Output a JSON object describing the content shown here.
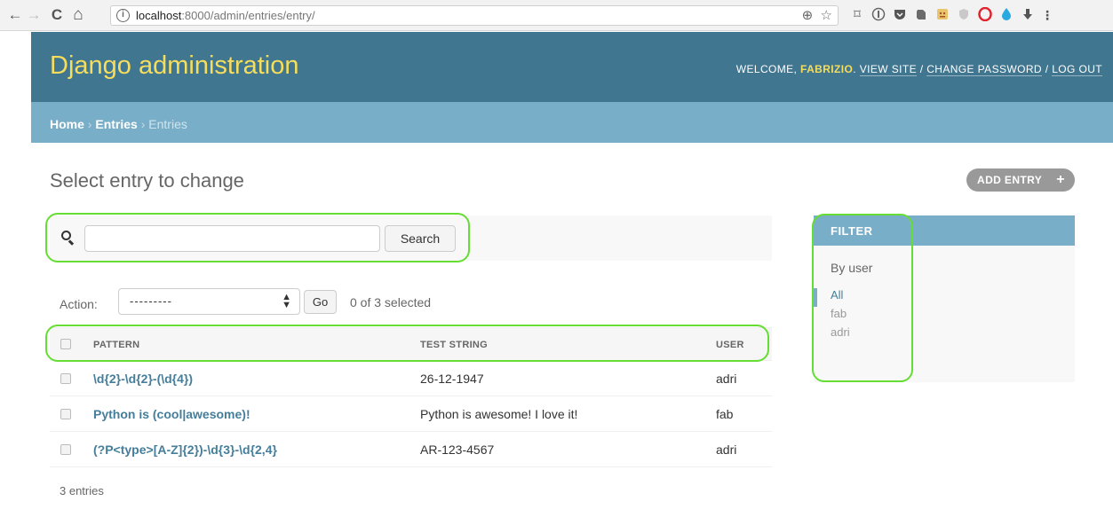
{
  "browser": {
    "url_host": "localhost",
    "url_rest": ":8000/admin/entries/entry/",
    "back_icon": "←",
    "forward_icon": "→",
    "reload_icon": "C",
    "home_icon": "⌂",
    "info_icon": "i",
    "zoom_icon": "⊕",
    "star_icon": "☆"
  },
  "header": {
    "site_title": "Django administration",
    "welcome": "WELCOME, ",
    "username": "FABRIZIO",
    "view_site": "VIEW SITE",
    "change_password": "CHANGE PASSWORD",
    "log_out": "LOG OUT",
    "separator": " / "
  },
  "breadcrumbs": {
    "home": "Home",
    "sep": " › ",
    "app": "Entries",
    "current": "Entries"
  },
  "page": {
    "title": "Select entry to change",
    "add_button": "ADD ENTRY",
    "add_icon": "+"
  },
  "search": {
    "value": "",
    "button": "Search"
  },
  "actions": {
    "label": "Action:",
    "selected_option": "---------",
    "go": "Go",
    "selected_count": "0 of 3 selected"
  },
  "table": {
    "columns": [
      "PATTERN",
      "TEST STRING",
      "USER"
    ],
    "rows": [
      {
        "pattern": "\\d{2}-\\d{2}-(\\d{4})",
        "test_string": "26-12-1947",
        "user": "adri"
      },
      {
        "pattern": "Python is (cool|awesome)!",
        "test_string": "Python is awesome! I love it!",
        "user": "fab"
      },
      {
        "pattern": "(?P<type>[A-Z]{2})-\\d{3}-\\d{2,4}",
        "test_string": "AR-123-4567",
        "user": "adri"
      }
    ],
    "footer": "3 entries"
  },
  "filter": {
    "title": "FILTER",
    "by": "By user",
    "options": [
      "All",
      "fab",
      "adri"
    ],
    "selected": "All"
  },
  "colors": {
    "header_bg": "#417690",
    "title_yellow": "#f5dd5d",
    "breadcrumb_bg": "#79aec8",
    "link": "#447e9b",
    "highlight": "#66dd33"
  }
}
